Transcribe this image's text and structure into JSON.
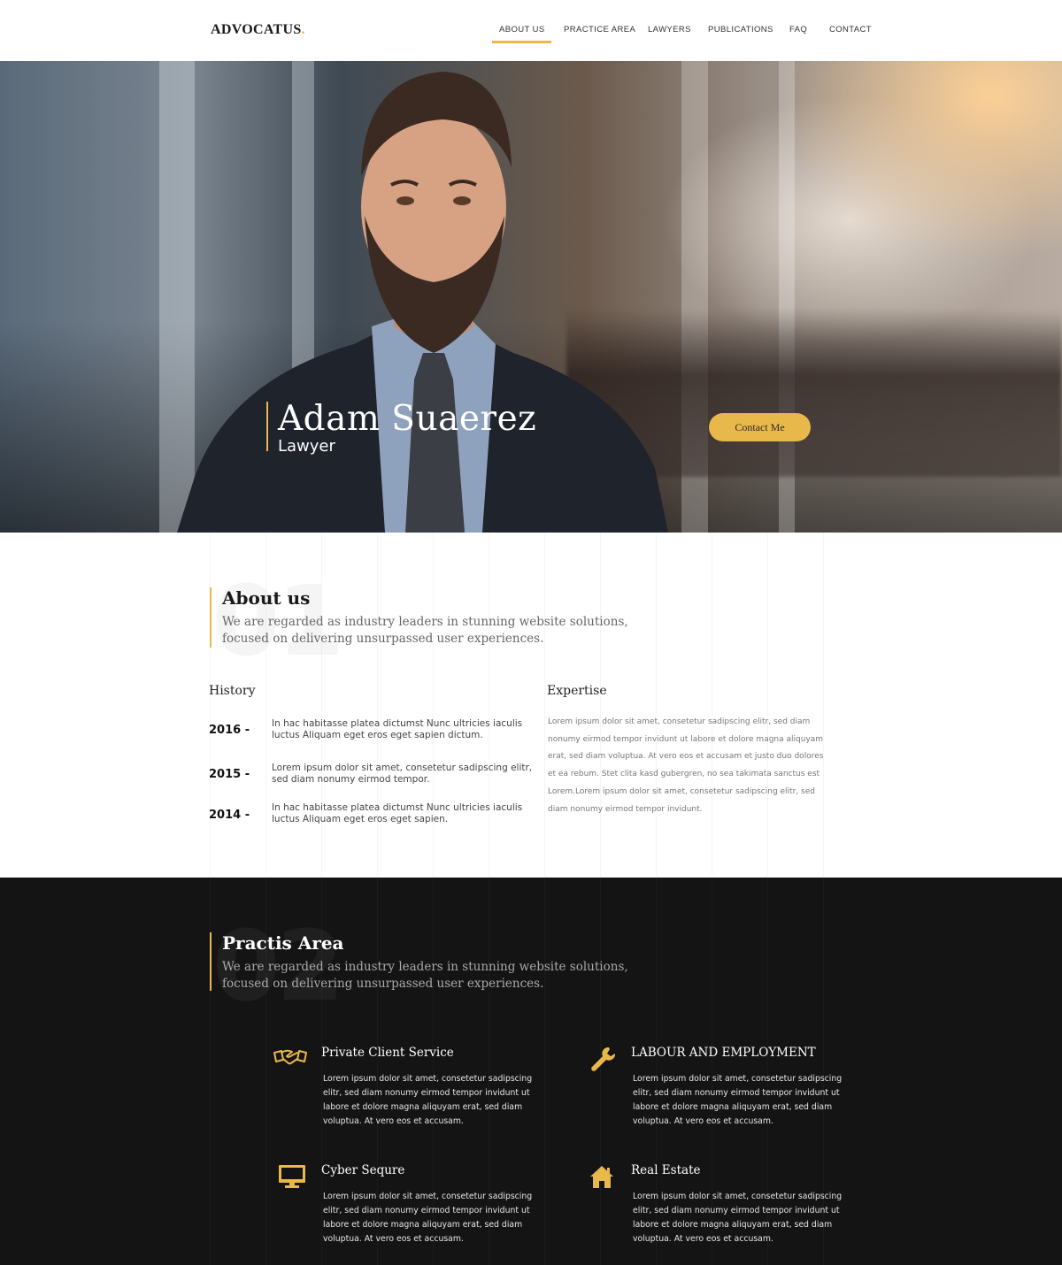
{
  "brand": {
    "name": "ADVOCATUS",
    "dot": ".",
    "accent": "#e8b84a"
  },
  "nav": {
    "items": [
      {
        "label": "ABOUT US",
        "active": true
      },
      {
        "label": "PRACTICE AREA",
        "active": false
      },
      {
        "label": "LAWYERS",
        "active": false
      },
      {
        "label": "PUBLICATIONS",
        "active": false
      },
      {
        "label": "FAQ",
        "active": false
      },
      {
        "label": "CONTACT",
        "active": false
      }
    ]
  },
  "hero": {
    "name": "Adam Suaerez",
    "role": "Lawyer",
    "cta": "Contact Me"
  },
  "about": {
    "number": "01",
    "title": "About us",
    "description": "We are regarded as industry leaders in stunning website solutions, focused on delivering unsurpassed user experiences.",
    "history_title": "History",
    "history": [
      {
        "year": "2016 -",
        "text": "In hac habitasse platea dictumst Nunc ultricies iaculis luctus Aliquam eget eros eget sapien dictum."
      },
      {
        "year": "2015 -",
        "text": "Lorem ipsum dolor sit amet, consetetur sadipscing elitr, sed diam nonumy eirmod tempor."
      },
      {
        "year": "2014 -",
        "text": "In hac habitasse platea dictumst Nunc ultricies iaculis luctus Aliquam eget eros eget sapien."
      }
    ],
    "expertise_title": "Expertise",
    "expertise_text": "Lorem ipsum dolor sit amet, consetetur sadipscing elitr, sed diam nonumy eirmod tempor invidunt ut labore et dolore magna aliquyam erat, sed diam voluptua. At vero eos et accusam et justo duo dolores et ea rebum. Stet clita kasd gubergren, no sea takimata sanctus est Lorem.Lorem ipsum dolor sit amet, consetetur sadipscing elitr, sed diam nonumy eirmod tempor invidunt."
  },
  "practice": {
    "number": "02",
    "title": "Practis Area",
    "description": "We are regarded as industry leaders in stunning website solutions, focused on delivering unsurpassed user experiences.",
    "cards": [
      {
        "icon": "handshake-icon",
        "title": "Private Client Service",
        "text": "Lorem ipsum dolor sit amet, consetetur sadipscing elitr, sed diam nonumy eirmod tempor invidunt ut labore et dolore magna aliquyam erat, sed diam voluptua. At vero eos et accusam."
      },
      {
        "icon": "wrench-icon",
        "title": "LABOUR AND EMPLOYMENT",
        "text": "Lorem ipsum dolor sit amet, consetetur sadipscing elitr, sed diam nonumy eirmod tempor invidunt ut labore et dolore magna aliquyam erat, sed diam voluptua. At vero eos et accusam."
      },
      {
        "icon": "monitor-icon",
        "title": "Cyber Sequre",
        "text": "Lorem ipsum dolor sit amet, consetetur sadipscing elitr, sed diam nonumy eirmod tempor invidunt ut labore et dolore magna aliquyam erat, sed diam voluptua. At vero eos et accusam."
      },
      {
        "icon": "house-icon",
        "title": "Real Estate",
        "text": "Lorem ipsum dolor sit amet, consetetur sadipscing elitr, sed diam nonumy eirmod tempor invidunt ut labore et dolore magna aliquyam erat, sed diam voluptua. At vero eos et accusam."
      }
    ]
  }
}
